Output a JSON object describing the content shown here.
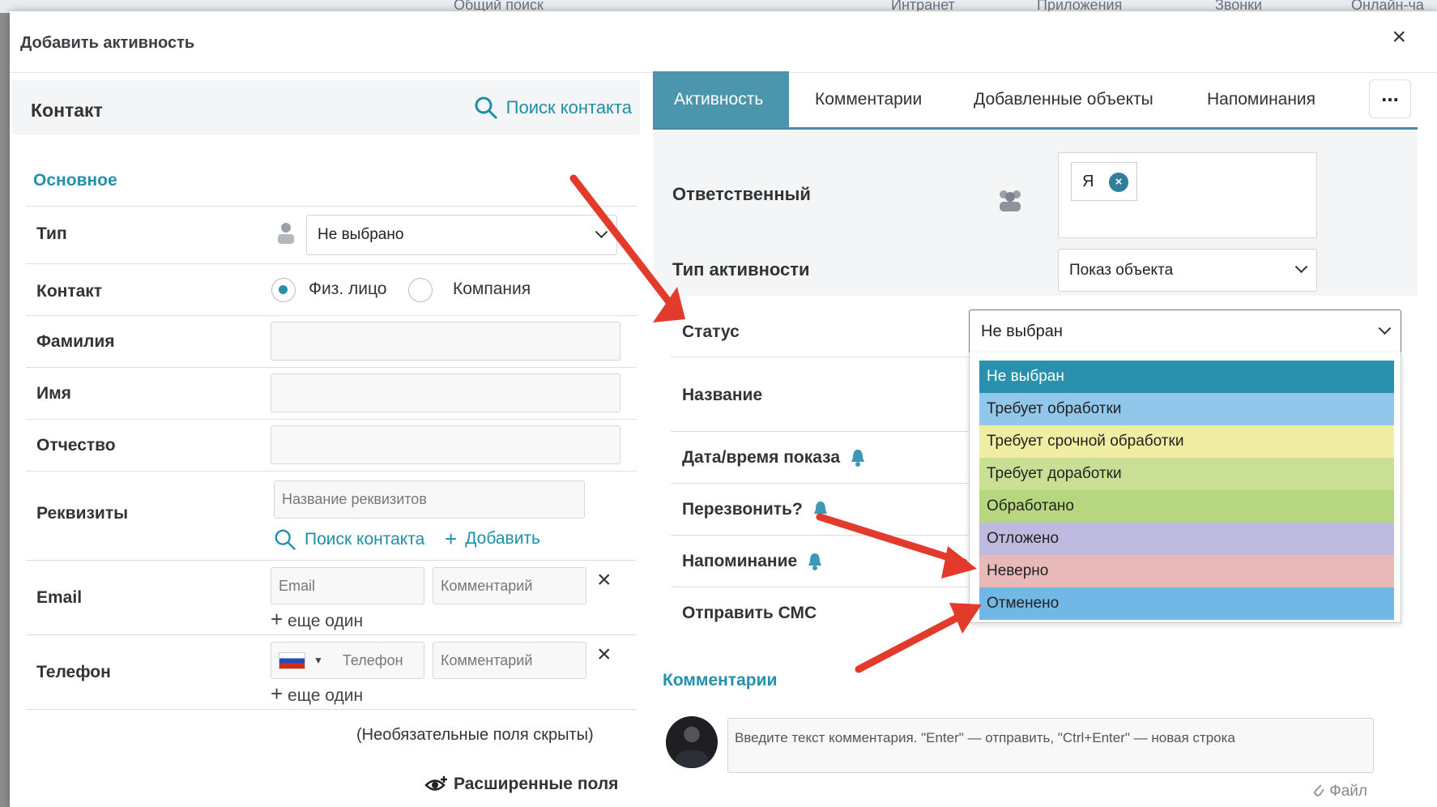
{
  "topbar": {
    "items": [
      "Общий поиск",
      "Интранет",
      "Приложения",
      "Звонки",
      "Онлайн-ча"
    ]
  },
  "modal": {
    "title": "Добавить активность",
    "close_glyph": "×"
  },
  "left": {
    "header_title": "Контакт",
    "search_link": "Поиск контакта",
    "section": "Основное",
    "type_label": "Тип",
    "type_value": "Не выбрано",
    "contact_label": "Контакт",
    "radio_person": "Физ. лицо",
    "radio_company": "Компания",
    "lastname_label": "Фамилия",
    "firstname_label": "Имя",
    "middlename_label": "Отчество",
    "requisites_label": "Реквизиты",
    "requisites_placeholder": "Название реквизитов",
    "requisites_search": "Поиск контакта",
    "requisites_add": "Добавить",
    "email_label": "Email",
    "email_placeholder": "Email",
    "comment_placeholder": "Комментарий",
    "add_another": "еще один",
    "phone_label": "Телефон",
    "phone_placeholder": "Телефон",
    "optional_hidden": "(Необязательные поля скрыты)",
    "extended_fields": "Расширенные поля"
  },
  "right": {
    "tabs": [
      "Активность",
      "Комментарии",
      "Добавленные объекты",
      "Напоминания"
    ],
    "more": "...",
    "responsible_label": "Ответственный",
    "responsible_chip": "Я",
    "activity_type_label": "Тип активности",
    "activity_type_value": "Показ объекта",
    "status_label": "Статус",
    "status_value": "Не выбран",
    "name_label": "Название",
    "show_datetime_label": "Дата/время показа",
    "callback_label": "Перезвонить?",
    "reminder_label": "Напоминание",
    "sms_label": "Отправить СМС",
    "comments_title": "Комментарии",
    "comment_placeholder": "Введите текст комментария. \"Enter\" — отправить, \"Ctrl+Enter\" — новая строка",
    "file_link": "Файл"
  },
  "status_options": [
    {
      "label": "Не выбран",
      "color": "#2990ad",
      "text": "#ffffff"
    },
    {
      "label": "Требует обработки",
      "color": "#90c7ea",
      "text": "#222222"
    },
    {
      "label": "Требует срочной обработки",
      "color": "#efeea3",
      "text": "#222222"
    },
    {
      "label": "Требует доработки",
      "color": "#c9e094",
      "text": "#222222"
    },
    {
      "label": "Обработано",
      "color": "#b6d77f",
      "text": "#222222"
    },
    {
      "label": "Отложено",
      "color": "#bdb9df",
      "text": "#222222"
    },
    {
      "label": "Неверно",
      "color": "#e8b9b9",
      "text": "#222222"
    },
    {
      "label": "Отменено",
      "color": "#72b8e6",
      "text": "#222222"
    }
  ],
  "colors": {
    "accent": "#2490ad",
    "tab_active": "#4b96ad",
    "annotation_arrow": "#e23a2b"
  }
}
